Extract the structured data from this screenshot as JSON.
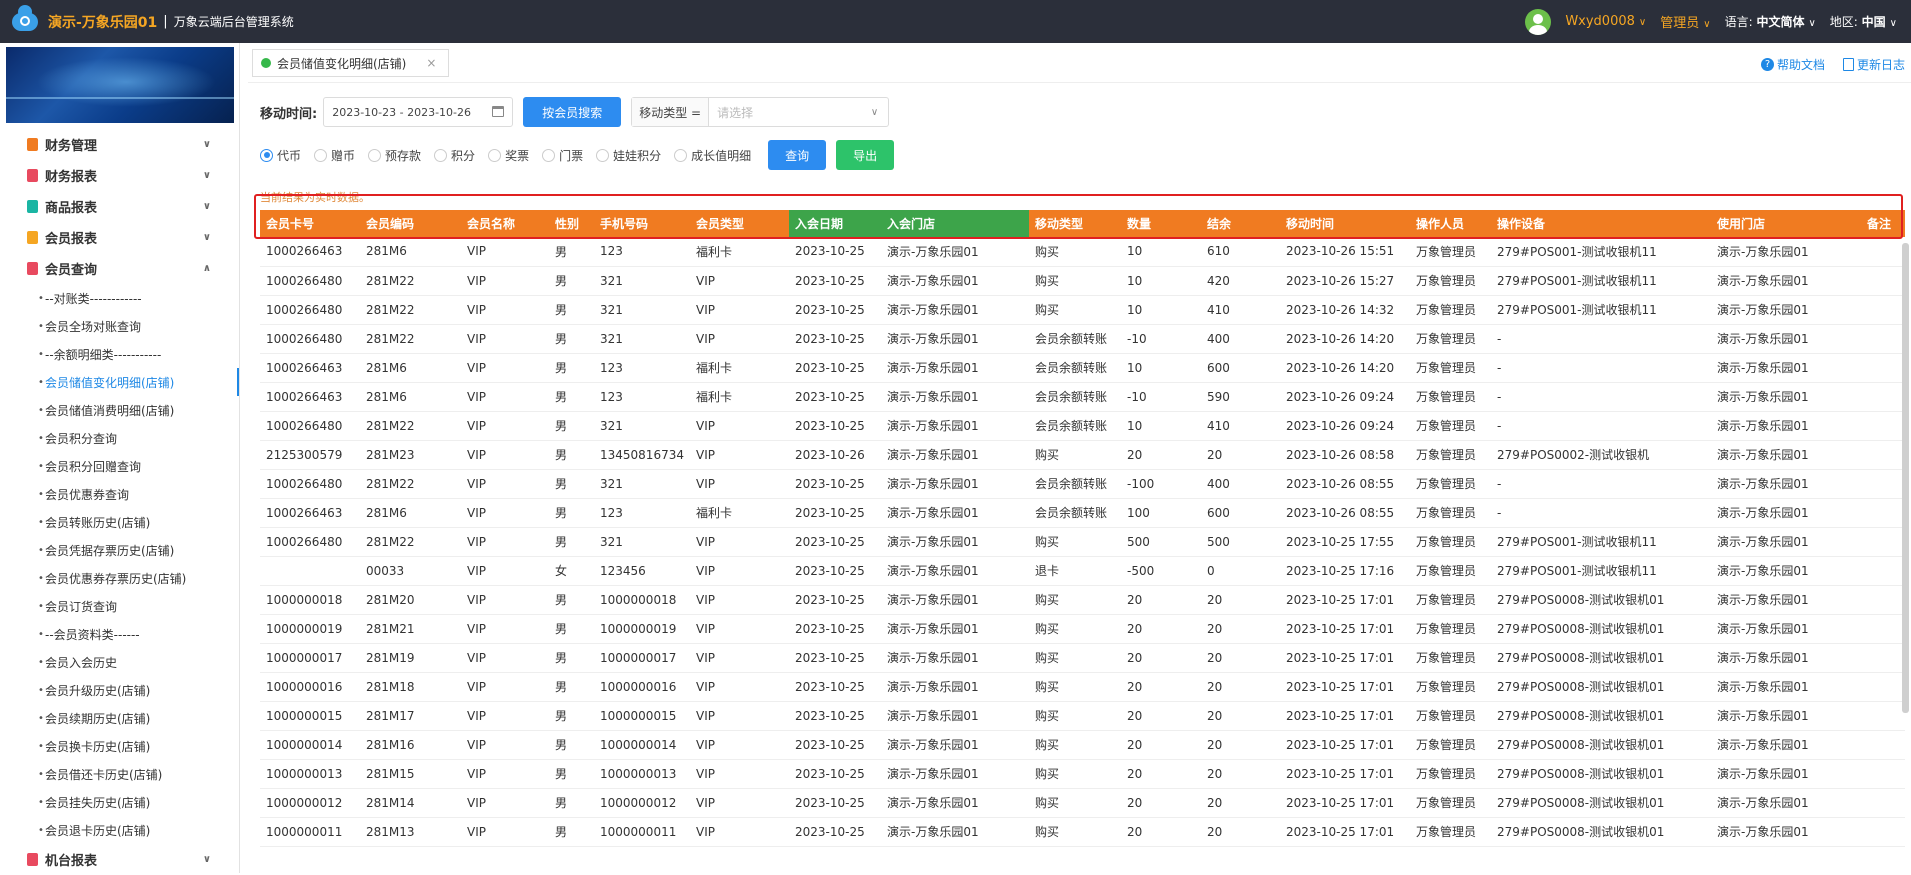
{
  "header": {
    "app_name": "演示-万象乐园01",
    "separator": "|",
    "system_name": "万象云端后台管理系统",
    "user": "Wxyd0008",
    "role": "管理员",
    "language_label": "语言:",
    "language_value": "中文简体",
    "region_label": "地区:",
    "region_value": "中国"
  },
  "sidebar": {
    "groups": [
      {
        "label": "财务管理",
        "color": "#f07b21"
      },
      {
        "label": "财务报表",
        "color": "#e84a5f"
      },
      {
        "label": "商品报表",
        "color": "#1ab5a3"
      },
      {
        "label": "会员报表",
        "color": "#f5a623"
      },
      {
        "label": "会员查询",
        "color": "#e84a5f"
      }
    ],
    "items": [
      "--对账类------------",
      "会员全场对账查询",
      "--余额明细类-----------",
      "会员储值变化明细(店铺)",
      "会员储值消费明细(店铺)",
      "会员积分查询",
      "会员积分回赠查询",
      "会员优惠券查询",
      "会员转账历史(店铺)",
      "会员凭据存票历史(店铺)",
      "会员优惠券存票历史(店铺)",
      "会员订货查询",
      "--会员资料类------",
      "会员入会历史",
      "会员升级历史(店铺)",
      "会员续期历史(店铺)",
      "会员换卡历史(店铺)",
      "会员借还卡历史(店铺)",
      "会员挂失历史(店铺)",
      "会员退卡历史(店铺)"
    ],
    "bottom_group": {
      "label": "机台报表",
      "color": "#e84a5f"
    }
  },
  "tabs": {
    "active_label": "会员储值变化明细(店铺)",
    "close": "×",
    "help_label": "帮助文档",
    "log_label": "更新日志"
  },
  "filters": {
    "move_time_label": "移动时间:",
    "date_range": "2023-10-23 - 2023-10-26",
    "search_by_member": "按会员搜索",
    "move_type_prefix": "移动类型 =",
    "move_type_placeholder": "请选择",
    "radios": [
      "代币",
      "赠币",
      "预存款",
      "积分",
      "奖票",
      "门票",
      "娃娃积分",
      "成长值明细"
    ],
    "query": "查询",
    "export": "导出"
  },
  "note": "当前结果为实时数据。",
  "table": {
    "columns": [
      "会员卡号",
      "会员编码",
      "会员名称",
      "性别",
      "手机号码",
      "会员类型",
      "入会日期",
      "入会门店",
      "移动类型",
      "数量",
      "结余",
      "移动时间",
      "操作人员",
      "操作设备",
      "使用门店",
      "备注"
    ],
    "rows": [
      [
        "1000266463",
        "281M6",
        "VIP",
        "男",
        "123",
        "福利卡",
        "2023-10-25",
        "演示-万象乐园01",
        "购买",
        "10",
        "610",
        "2023-10-26 15:51",
        "万象管理员",
        "279#POS001-测试收银机11",
        "演示-万象乐园01",
        ""
      ],
      [
        "1000266480",
        "281M22",
        "VIP",
        "男",
        "321",
        "VIP",
        "2023-10-25",
        "演示-万象乐园01",
        "购买",
        "10",
        "420",
        "2023-10-26 15:27",
        "万象管理员",
        "279#POS001-测试收银机11",
        "演示-万象乐园01",
        ""
      ],
      [
        "1000266480",
        "281M22",
        "VIP",
        "男",
        "321",
        "VIP",
        "2023-10-25",
        "演示-万象乐园01",
        "购买",
        "10",
        "410",
        "2023-10-26 14:32",
        "万象管理员",
        "279#POS001-测试收银机11",
        "演示-万象乐园01",
        ""
      ],
      [
        "1000266480",
        "281M22",
        "VIP",
        "男",
        "321",
        "VIP",
        "2023-10-25",
        "演示-万象乐园01",
        "会员余额转账",
        "-10",
        "400",
        "2023-10-26 14:20",
        "万象管理员",
        "-",
        "演示-万象乐园01",
        ""
      ],
      [
        "1000266463",
        "281M6",
        "VIP",
        "男",
        "123",
        "福利卡",
        "2023-10-25",
        "演示-万象乐园01",
        "会员余额转账",
        "10",
        "600",
        "2023-10-26 14:20",
        "万象管理员",
        "-",
        "演示-万象乐园01",
        ""
      ],
      [
        "1000266463",
        "281M6",
        "VIP",
        "男",
        "123",
        "福利卡",
        "2023-10-25",
        "演示-万象乐园01",
        "会员余额转账",
        "-10",
        "590",
        "2023-10-26 09:24",
        "万象管理员",
        "-",
        "演示-万象乐园01",
        ""
      ],
      [
        "1000266480",
        "281M22",
        "VIP",
        "男",
        "321",
        "VIP",
        "2023-10-25",
        "演示-万象乐园01",
        "会员余额转账",
        "10",
        "410",
        "2023-10-26 09:24",
        "万象管理员",
        "-",
        "演示-万象乐园01",
        ""
      ],
      [
        "2125300579",
        "281M23",
        "VIP",
        "男",
        "13450816734",
        "VIP",
        "2023-10-26",
        "演示-万象乐园01",
        "购买",
        "20",
        "20",
        "2023-10-26 08:58",
        "万象管理员",
        "279#POS0002-测试收银机",
        "演示-万象乐园01",
        ""
      ],
      [
        "1000266480",
        "281M22",
        "VIP",
        "男",
        "321",
        "VIP",
        "2023-10-25",
        "演示-万象乐园01",
        "会员余额转账",
        "-100",
        "400",
        "2023-10-26 08:55",
        "万象管理员",
        "-",
        "演示-万象乐园01",
        ""
      ],
      [
        "1000266463",
        "281M6",
        "VIP",
        "男",
        "123",
        "福利卡",
        "2023-10-25",
        "演示-万象乐园01",
        "会员余额转账",
        "100",
        "600",
        "2023-10-26 08:55",
        "万象管理员",
        "-",
        "演示-万象乐园01",
        ""
      ],
      [
        "1000266480",
        "281M22",
        "VIP",
        "男",
        "321",
        "VIP",
        "2023-10-25",
        "演示-万象乐园01",
        "购买",
        "500",
        "500",
        "2023-10-25 17:55",
        "万象管理员",
        "279#POS001-测试收银机11",
        "演示-万象乐园01",
        ""
      ],
      [
        "",
        "00033",
        "VIP",
        "女",
        "123456",
        "VIP",
        "2023-10-25",
        "演示-万象乐园01",
        "退卡",
        "-500",
        "0",
        "2023-10-25 17:16",
        "万象管理员",
        "279#POS001-测试收银机11",
        "演示-万象乐园01",
        ""
      ],
      [
        "1000000018",
        "281M20",
        "VIP",
        "男",
        "1000000018",
        "VIP",
        "2023-10-25",
        "演示-万象乐园01",
        "购买",
        "20",
        "20",
        "2023-10-25 17:01",
        "万象管理员",
        "279#POS0008-测试收银机01",
        "演示-万象乐园01",
        ""
      ],
      [
        "1000000019",
        "281M21",
        "VIP",
        "男",
        "1000000019",
        "VIP",
        "2023-10-25",
        "演示-万象乐园01",
        "购买",
        "20",
        "20",
        "2023-10-25 17:01",
        "万象管理员",
        "279#POS0008-测试收银机01",
        "演示-万象乐园01",
        ""
      ],
      [
        "1000000017",
        "281M19",
        "VIP",
        "男",
        "1000000017",
        "VIP",
        "2023-10-25",
        "演示-万象乐园01",
        "购买",
        "20",
        "20",
        "2023-10-25 17:01",
        "万象管理员",
        "279#POS0008-测试收银机01",
        "演示-万象乐园01",
        ""
      ],
      [
        "1000000016",
        "281M18",
        "VIP",
        "男",
        "1000000016",
        "VIP",
        "2023-10-25",
        "演示-万象乐园01",
        "购买",
        "20",
        "20",
        "2023-10-25 17:01",
        "万象管理员",
        "279#POS0008-测试收银机01",
        "演示-万象乐园01",
        ""
      ],
      [
        "1000000015",
        "281M17",
        "VIP",
        "男",
        "1000000015",
        "VIP",
        "2023-10-25",
        "演示-万象乐园01",
        "购买",
        "20",
        "20",
        "2023-10-25 17:01",
        "万象管理员",
        "279#POS0008-测试收银机01",
        "演示-万象乐园01",
        ""
      ],
      [
        "1000000014",
        "281M16",
        "VIP",
        "男",
        "1000000014",
        "VIP",
        "2023-10-25",
        "演示-万象乐园01",
        "购买",
        "20",
        "20",
        "2023-10-25 17:01",
        "万象管理员",
        "279#POS0008-测试收银机01",
        "演示-万象乐园01",
        ""
      ],
      [
        "1000000013",
        "281M15",
        "VIP",
        "男",
        "1000000013",
        "VIP",
        "2023-10-25",
        "演示-万象乐园01",
        "购买",
        "20",
        "20",
        "2023-10-25 17:01",
        "万象管理员",
        "279#POS0008-测试收银机01",
        "演示-万象乐园01",
        ""
      ],
      [
        "1000000012",
        "281M14",
        "VIP",
        "男",
        "1000000012",
        "VIP",
        "2023-10-25",
        "演示-万象乐园01",
        "购买",
        "20",
        "20",
        "2023-10-25 17:01",
        "万象管理员",
        "279#POS0008-测试收银机01",
        "演示-万象乐园01",
        ""
      ],
      [
        "1000000011",
        "281M13",
        "VIP",
        "男",
        "1000000011",
        "VIP",
        "2023-10-25",
        "演示-万象乐园01",
        "购买",
        "20",
        "20",
        "2023-10-25 17:01",
        "万象管理员",
        "279#POS0008-测试收银机01",
        "演示-万象乐园01",
        ""
      ]
    ]
  }
}
